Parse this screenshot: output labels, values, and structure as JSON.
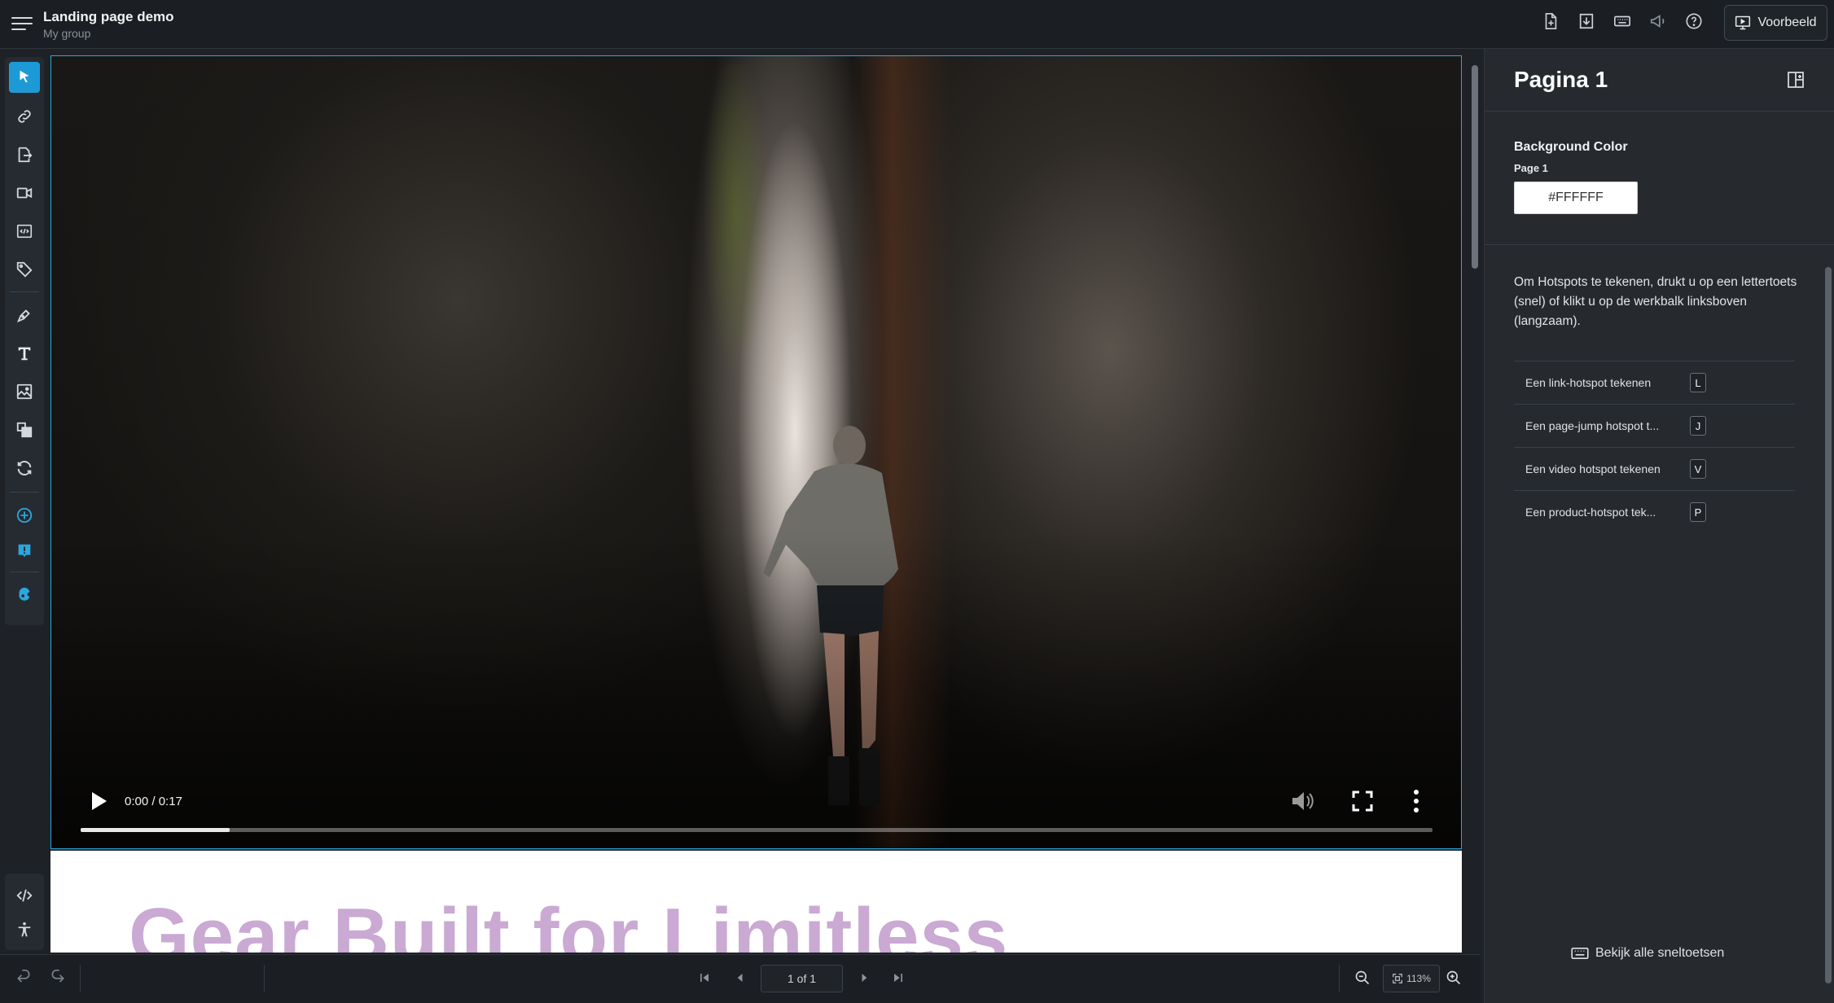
{
  "header": {
    "title": "Landing page demo",
    "subtitle": "My group",
    "preview_label": "Voorbeeld",
    "icons": [
      "add-page-icon",
      "download-icon",
      "keyboard-icon",
      "announcement-icon",
      "help-icon"
    ]
  },
  "left_toolbar": {
    "tools": [
      "select-tool",
      "link-hotspot-tool",
      "page-jump-tool",
      "video-hotspot-tool",
      "embed-tool",
      "product-tag-tool",
      "pen-tool",
      "text-tool",
      "image-tool",
      "layers-tool",
      "swap-tool",
      "add-widget-tool",
      "chat-widget-tool",
      "extension-tool"
    ],
    "bottom_tools": [
      "code-tool",
      "accessibility-tool"
    ]
  },
  "canvas": {
    "video": {
      "time": "0:00 / 0:17",
      "progress": 0.11
    },
    "headline": "Gear Built for Limitless"
  },
  "pager": {
    "page_text": "1 of 1",
    "zoom": "113%"
  },
  "right_panel": {
    "title": "Pagina 1",
    "background": {
      "label": "Background Color",
      "page_label": "Page 1",
      "value": "#FFFFFF"
    },
    "help_text": "Om Hotspots te tekenen, drukt u op een lettertoets (snel) of klikt u op de werkbalk linksboven (langzaam).",
    "shortcuts": [
      {
        "label": "Een link-hotspot tekenen",
        "key": "L"
      },
      {
        "label": "Een page-jump hotspot t...",
        "key": "J"
      },
      {
        "label": "Een video hotspot tekenen",
        "key": "V"
      },
      {
        "label": "Een product-hotspot tek...",
        "key": "P"
      }
    ],
    "all_shortcuts_label": "Bekijk alle sneltoetsen"
  },
  "colors": {
    "accent": "#1d9ad6",
    "headline": "#caa9d3",
    "panel_bg": "#262a2f",
    "topbar_bg": "#1b1f24"
  }
}
